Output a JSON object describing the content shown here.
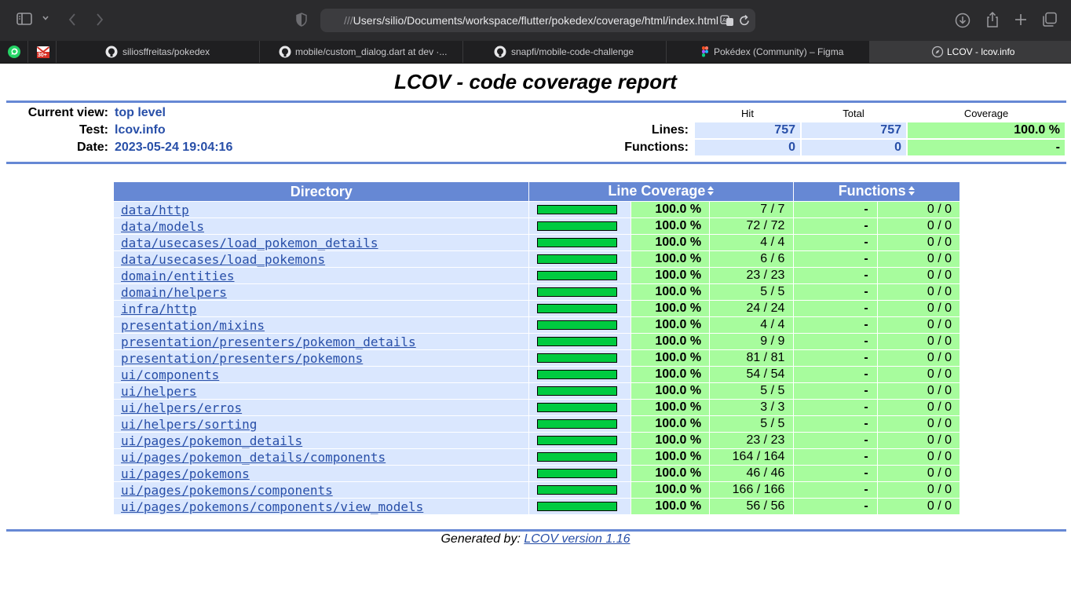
{
  "browser": {
    "url_prefix": "///",
    "url_path": "Users/silio/Documents/workspace/flutter/pokedex/coverage/html/index.html",
    "pinned_tabs": [
      {
        "icon": "whatsapp-icon"
      },
      {
        "icon": "gmail-icon",
        "badge": "30+"
      }
    ],
    "tabs": [
      {
        "label": "siliosffreitas/pokedex",
        "icon": "github-icon"
      },
      {
        "label": "mobile/custom_dialog.dart at dev ·...",
        "icon": "github-icon"
      },
      {
        "label": "snapfi/mobile-code-challenge",
        "icon": "github-icon"
      },
      {
        "label": "Pokédex (Community) – Figma",
        "icon": "figma-icon"
      },
      {
        "label": "LCOV - lcov.info",
        "icon": "compass-icon",
        "active": true
      }
    ]
  },
  "report": {
    "title": "LCOV - code coverage report",
    "current_view_label": "Current view:",
    "current_view_value": "top level",
    "test_label": "Test:",
    "test_value": "lcov.info",
    "date_label": "Date:",
    "date_value": "2023-05-24 19:04:16",
    "col_hit": "Hit",
    "col_total": "Total",
    "col_coverage": "Coverage",
    "lines_label": "Lines:",
    "lines_hit": "757",
    "lines_total": "757",
    "lines_coverage": "100.0 %",
    "functions_label": "Functions:",
    "functions_hit": "0",
    "functions_total": "0",
    "functions_coverage": "-"
  },
  "table": {
    "header_directory": "Directory",
    "header_line_coverage": "Line Coverage",
    "header_functions": "Functions",
    "rows": [
      {
        "dir": "data/http",
        "pct": "100.0 %",
        "coverage": 1.0,
        "lines": "7 / 7",
        "fpct": "-",
        "funcs": "0 / 0"
      },
      {
        "dir": "data/models",
        "pct": "100.0 %",
        "coverage": 1.0,
        "lines": "72 / 72",
        "fpct": "-",
        "funcs": "0 / 0"
      },
      {
        "dir": "data/usecases/load_pokemon_details",
        "pct": "100.0 %",
        "coverage": 1.0,
        "lines": "4 / 4",
        "fpct": "-",
        "funcs": "0 / 0"
      },
      {
        "dir": "data/usecases/load_pokemons",
        "pct": "100.0 %",
        "coverage": 1.0,
        "lines": "6 / 6",
        "fpct": "-",
        "funcs": "0 / 0"
      },
      {
        "dir": "domain/entities",
        "pct": "100.0 %",
        "coverage": 1.0,
        "lines": "23 / 23",
        "fpct": "-",
        "funcs": "0 / 0"
      },
      {
        "dir": "domain/helpers",
        "pct": "100.0 %",
        "coverage": 1.0,
        "lines": "5 / 5",
        "fpct": "-",
        "funcs": "0 / 0"
      },
      {
        "dir": "infra/http",
        "pct": "100.0 %",
        "coverage": 1.0,
        "lines": "24 / 24",
        "fpct": "-",
        "funcs": "0 / 0"
      },
      {
        "dir": "presentation/mixins",
        "pct": "100.0 %",
        "coverage": 1.0,
        "lines": "4 / 4",
        "fpct": "-",
        "funcs": "0 / 0"
      },
      {
        "dir": "presentation/presenters/pokemon_details",
        "pct": "100.0 %",
        "coverage": 1.0,
        "lines": "9 / 9",
        "fpct": "-",
        "funcs": "0 / 0"
      },
      {
        "dir": "presentation/presenters/pokemons",
        "pct": "100.0 %",
        "coverage": 1.0,
        "lines": "81 / 81",
        "fpct": "-",
        "funcs": "0 / 0"
      },
      {
        "dir": "ui/components",
        "pct": "100.0 %",
        "coverage": 1.0,
        "lines": "54 / 54",
        "fpct": "-",
        "funcs": "0 / 0"
      },
      {
        "dir": "ui/helpers",
        "pct": "100.0 %",
        "coverage": 1.0,
        "lines": "5 / 5",
        "fpct": "-",
        "funcs": "0 / 0"
      },
      {
        "dir": "ui/helpers/erros",
        "pct": "100.0 %",
        "coverage": 1.0,
        "lines": "3 / 3",
        "fpct": "-",
        "funcs": "0 / 0"
      },
      {
        "dir": "ui/helpers/sorting",
        "pct": "100.0 %",
        "coverage": 1.0,
        "lines": "5 / 5",
        "fpct": "-",
        "funcs": "0 / 0"
      },
      {
        "dir": "ui/pages/pokemon_details",
        "pct": "100.0 %",
        "coverage": 1.0,
        "lines": "23 / 23",
        "fpct": "-",
        "funcs": "0 / 0"
      },
      {
        "dir": "ui/pages/pokemon_details/components",
        "pct": "100.0 %",
        "coverage": 1.0,
        "lines": "164 / 164",
        "fpct": "-",
        "funcs": "0 / 0"
      },
      {
        "dir": "ui/pages/pokemons",
        "pct": "100.0 %",
        "coverage": 1.0,
        "lines": "46 / 46",
        "fpct": "-",
        "funcs": "0 / 0"
      },
      {
        "dir": "ui/pages/pokemons/components",
        "pct": "100.0 %",
        "coverage": 1.0,
        "lines": "166 / 166",
        "fpct": "-",
        "funcs": "0 / 0"
      },
      {
        "dir": "ui/pages/pokemons/components/view_models",
        "pct": "100.0 %",
        "coverage": 1.0,
        "lines": "56 / 56",
        "fpct": "-",
        "funcs": "0 / 0"
      }
    ]
  },
  "footer": {
    "prefix": "Generated by: ",
    "link": "LCOV version 1.16"
  },
  "colors": {
    "header_blue": "#6688d4",
    "row_blue": "#dae7fe",
    "hit_green": "#a7fc9d",
    "bar_green": "#00cb40",
    "link_blue": "#284fa8"
  }
}
